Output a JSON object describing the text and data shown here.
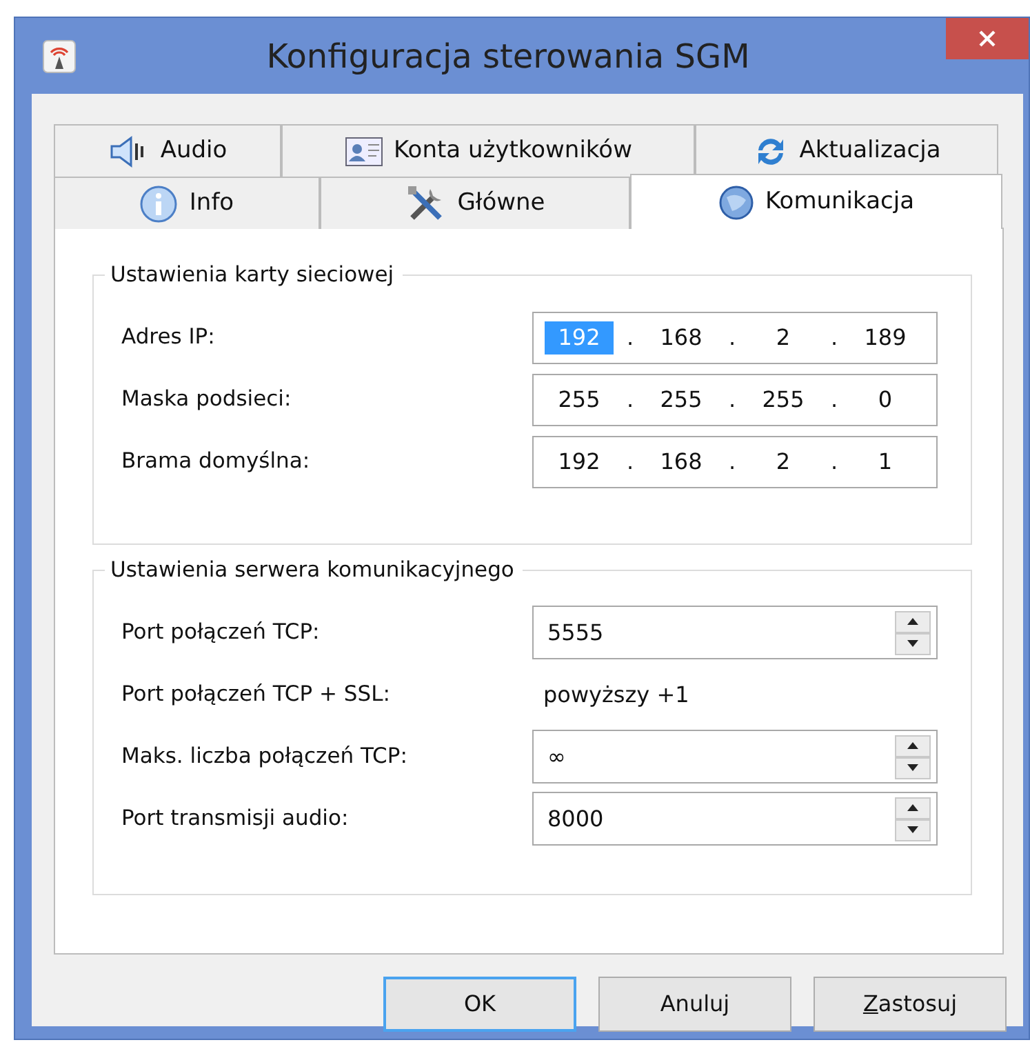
{
  "window": {
    "title": "Konfiguracja sterowania SGM"
  },
  "tab_rows": [
    [
      {
        "label": "Audio",
        "selected": false
      },
      {
        "label": "Konta użytkowników",
        "selected": false
      },
      {
        "label": "Aktualizacja",
        "selected": false
      }
    ],
    [
      {
        "label": "Info",
        "selected": false
      },
      {
        "label": "Główne",
        "selected": false
      },
      {
        "label": "Komunikacja",
        "selected": true
      }
    ]
  ],
  "groups": [
    {
      "title": "Ustawienia karty sieciowej",
      "rows": [
        {
          "kind": "ip",
          "label": "Adres IP:",
          "separator": ".",
          "octets": [
            {
              "text": "192",
              "selected": true
            },
            {
              "text": "168",
              "selected": false
            },
            {
              "text": "2",
              "selected": false
            },
            {
              "text": "189",
              "selected": false
            }
          ]
        },
        {
          "kind": "ip",
          "label": "Maska podsieci:",
          "separator": ".",
          "octets": [
            {
              "text": "255",
              "selected": false
            },
            {
              "text": "255",
              "selected": false
            },
            {
              "text": "255",
              "selected": false
            },
            {
              "text": "0",
              "selected": false
            }
          ]
        },
        {
          "kind": "ip",
          "label": "Brama domyślna:",
          "separator": ".",
          "octets": [
            {
              "text": "192",
              "selected": false
            },
            {
              "text": "168",
              "selected": false
            },
            {
              "text": "2",
              "selected": false
            },
            {
              "text": "1",
              "selected": false
            }
          ]
        }
      ]
    },
    {
      "title": "Ustawienia serwera komunikacyjnego",
      "rows": [
        {
          "kind": "spin",
          "label": "Port połączeń TCP:",
          "value": "5555"
        },
        {
          "kind": "text",
          "label": "Port połączeń TCP + SSL:",
          "value": "powyższy +1"
        },
        {
          "kind": "spin",
          "label": "Maks. liczba połączeń TCP:",
          "value": "∞"
        },
        {
          "kind": "spin",
          "label": "Port transmisji audio:",
          "value": "8000"
        }
      ]
    }
  ],
  "buttons": [
    {
      "label": "OK",
      "default": true
    },
    {
      "label": "Anuluj",
      "default": false
    },
    {
      "label": "Zastosuj",
      "default": false,
      "mnemonic_underlined": true
    }
  ]
}
